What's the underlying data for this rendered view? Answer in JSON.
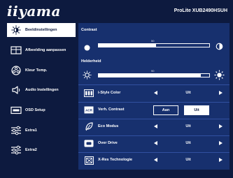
{
  "header": {
    "logo": "iiyama",
    "model": "ProLite XUB2490HSUH"
  },
  "sidebar": {
    "items": [
      {
        "label": "Beeldinstellingen",
        "icon": "brightness-icon",
        "active": true
      },
      {
        "label": "Afbeelding aanpassen",
        "icon": "picture-adjust-icon",
        "active": false
      },
      {
        "label": "Kleur Temp.",
        "icon": "color-palette-icon",
        "active": false
      },
      {
        "label": "Audio Instellingen",
        "icon": "speaker-icon",
        "active": false
      },
      {
        "label": "OSD Setup",
        "icon": "osd-menu-icon",
        "active": false
      },
      {
        "label": "Extra1",
        "icon": "sliders-icon",
        "active": false
      },
      {
        "label": "Extra2",
        "icon": "sliders-icon",
        "active": false
      }
    ]
  },
  "main": {
    "contrast": {
      "title": "Contrast",
      "value": "50",
      "level_fraction": 0.52
    },
    "brightness": {
      "title": "Helderheid",
      "value": "90",
      "level_fraction": 0.92
    },
    "settings": [
      {
        "label": "i-Style Color",
        "icon": "istyle-icon",
        "type": "select",
        "value": "Uit"
      },
      {
        "label": "Verh. Contrast",
        "icon": "acr-icon",
        "type": "toggle",
        "off_label": "Aan",
        "on_label": "Uit"
      },
      {
        "label": "Eco Modus",
        "icon": "eco-leaf-icon",
        "type": "select",
        "value": "Uit"
      },
      {
        "label": "Over Drive",
        "icon": "overdrive-icon",
        "type": "select",
        "value": "Uit"
      },
      {
        "label": "X-Res Technologie",
        "icon": "xres-icon",
        "type": "select",
        "value": "Uit"
      }
    ]
  },
  "colors": {
    "background": "#0d1a3f",
    "panel": "#17306e",
    "highlight": "#ffffff",
    "divider": "#3150a0"
  }
}
